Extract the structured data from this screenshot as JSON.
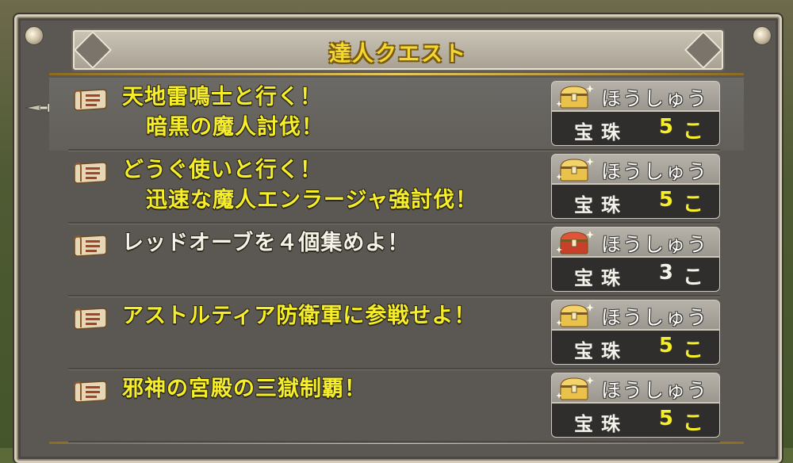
{
  "window": {
    "title": "達人クエスト"
  },
  "quests": [
    {
      "line1": "天地雷鳴士と行く！",
      "line2": "暗黒の魔人討伐！",
      "color": "yellow",
      "selected": true,
      "reward_label": "ほうしゅう",
      "reward_item": "宝珠",
      "reward_qty": "5",
      "reward_unit": "こ",
      "chest": "gold-chest-icon"
    },
    {
      "line1": "どうぐ使いと行く！",
      "line2": "迅速な魔人エンラージャ強討伐！",
      "color": "yellow",
      "selected": false,
      "reward_label": "ほうしゅう",
      "reward_item": "宝珠",
      "reward_qty": "5",
      "reward_unit": "こ",
      "chest": "gold-chest-icon"
    },
    {
      "line1": "レッドオーブを４個集めよ！",
      "line2": "",
      "color": "white",
      "selected": false,
      "reward_label": "ほうしゅう",
      "reward_item": "宝珠",
      "reward_qty": "3",
      "reward_unit": "こ",
      "chest": "red-chest-icon"
    },
    {
      "line1": "アストルティア防衛軍に参戦せよ！",
      "line2": "",
      "color": "yellow",
      "selected": false,
      "reward_label": "ほうしゅう",
      "reward_item": "宝珠",
      "reward_qty": "5",
      "reward_unit": "こ",
      "chest": "gold-chest-icon"
    },
    {
      "line1": "邪神の宮殿の三獄制覇！",
      "line2": "",
      "color": "yellow",
      "selected": false,
      "reward_label": "ほうしゅう",
      "reward_item": "宝珠",
      "reward_qty": "5",
      "reward_unit": "こ",
      "chest": "gold-chest-icon"
    }
  ],
  "colors": {
    "quest_yellow": "#f7ee2a",
    "quest_white": "#f4f2ea",
    "title_gold": "#f2d830",
    "panel": "#5b5853"
  }
}
